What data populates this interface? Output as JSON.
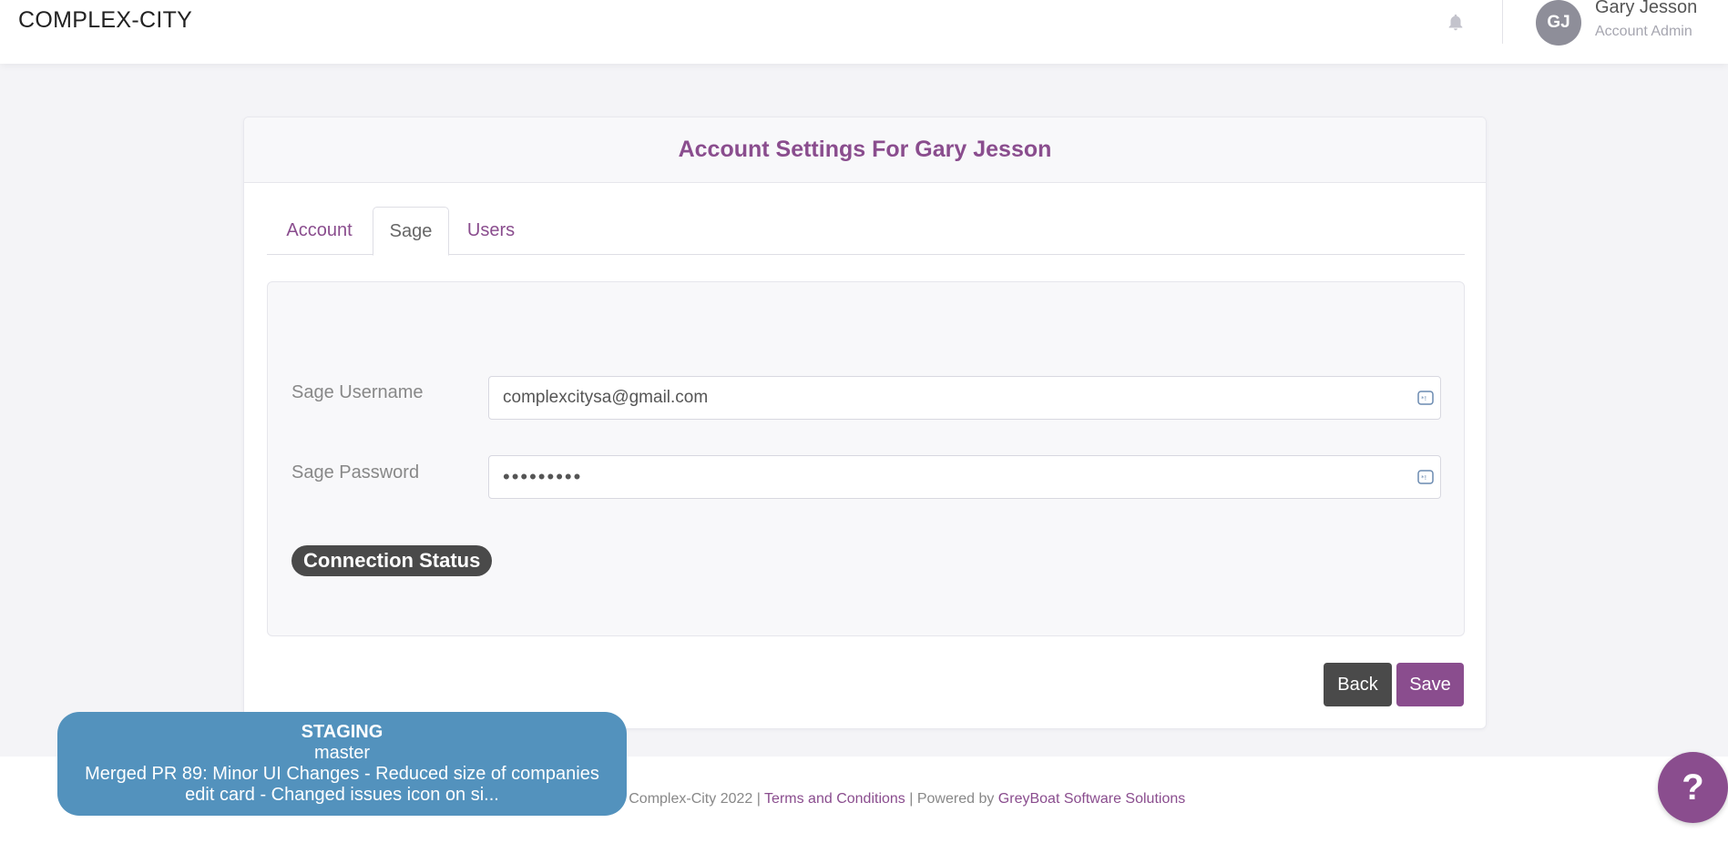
{
  "header": {
    "brand": "COMPLEX-CITY",
    "user": {
      "initials": "GJ",
      "name": "Gary Jesson",
      "role": "Account Admin"
    },
    "icons": [
      "bell-icon"
    ]
  },
  "card": {
    "title": "Account Settings For Gary Jesson",
    "tabs": [
      {
        "label": "Account",
        "active": false
      },
      {
        "label": "Sage",
        "active": true
      },
      {
        "label": "Users",
        "active": false
      }
    ],
    "form": {
      "username_label": "Sage Username",
      "username_value": "complexcitysa@gmail.com",
      "password_label": "Sage Password",
      "password_value": "•••••••••"
    },
    "connection_status_label": "Connection Status",
    "buttons": {
      "back": "Back",
      "save": "Save"
    }
  },
  "footer": {
    "copyright": "© Complex-City 2022 |",
    "terms": "Terms and Conditions",
    "powered_prefix": "| Powered by",
    "powered_link": "GreyBoat Software Solutions"
  },
  "staging": {
    "env": "STAGING",
    "branch": "master",
    "commit_line1": "Merged PR 89: Minor UI Changes - Reduced size of companies",
    "commit_line2": "edit card - Changed issues icon on si..."
  },
  "help": {
    "label": "?"
  },
  "colors": {
    "accent": "#8a4d8e",
    "dark_button": "#4a4a4a",
    "staging_bg": "#5392bd"
  }
}
